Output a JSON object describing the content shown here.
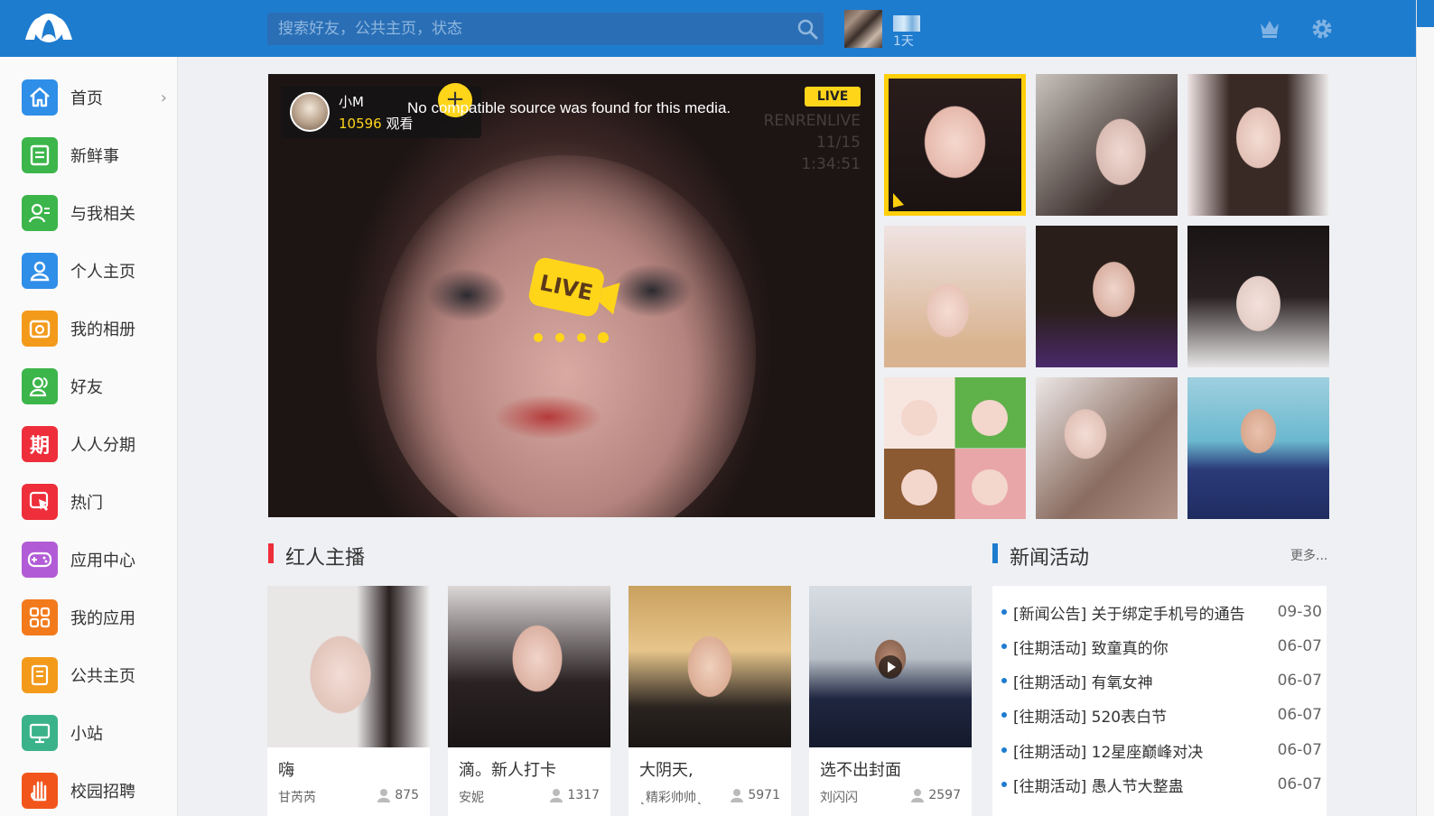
{
  "search": {
    "placeholder": "搜索好友，公共主页，状态"
  },
  "user": {
    "day_label": "1天"
  },
  "sidebar": {
    "items": [
      {
        "label": "首页",
        "icon": "home-icon",
        "color": "#2f8ee8"
      },
      {
        "label": "新鲜事",
        "icon": "news-feed-icon",
        "color": "#3cb54a"
      },
      {
        "label": "与我相关",
        "icon": "related-icon",
        "color": "#3cb54a"
      },
      {
        "label": "个人主页",
        "icon": "profile-icon",
        "color": "#2f8ee8"
      },
      {
        "label": "我的相册",
        "icon": "album-icon",
        "color": "#f39a1b"
      },
      {
        "label": "好友",
        "icon": "friends-icon",
        "color": "#3cb54a"
      },
      {
        "label": "人人分期",
        "icon": "installment-icon",
        "color": "#ee2e3a",
        "glyph": "期"
      },
      {
        "label": "热门",
        "icon": "hot-icon",
        "color": "#ee2e3a"
      },
      {
        "label": "应用中心",
        "icon": "gamepad-icon",
        "color": "#b25bd6"
      },
      {
        "label": "我的应用",
        "icon": "apps-icon",
        "color": "#f27a1b"
      },
      {
        "label": "公共主页",
        "icon": "public-page-icon",
        "color": "#f39a1b"
      },
      {
        "label": "小站",
        "icon": "station-icon",
        "color": "#3ab28a"
      },
      {
        "label": "校园招聘",
        "icon": "recruit-icon",
        "color": "#f2551b"
      }
    ]
  },
  "live": {
    "host_name": "小M",
    "viewers": "10596",
    "viewers_suffix": " 观看",
    "follow_label": "+",
    "error": "No compatible source was found for this media.",
    "badge": "LIVE",
    "watermark_line1": "RENRENLIVE 11/15",
    "watermark_line2": "1:34:51",
    "center_logo_text": "LIVE"
  },
  "sections": {
    "anchors_title": "红人主播",
    "news_title": "新闻活动",
    "more": "更多..."
  },
  "anchors": [
    {
      "title": "嗨",
      "name": "甘芮芮",
      "count": "875"
    },
    {
      "title": "滴。新人打卡",
      "name": "安妮",
      "count": "1317"
    },
    {
      "title": "大阴天,",
      "name": "˛精彩帅帅˛",
      "count": "5971"
    },
    {
      "title": "选不出封面",
      "name": "刘闪闪",
      "count": "2597"
    }
  ],
  "news": [
    {
      "title": "[新闻公告] 关于绑定手机号的通告",
      "date": "09-30"
    },
    {
      "title": "[往期活动] 致童真的你",
      "date": "06-07"
    },
    {
      "title": "[往期活动] 有氧女神",
      "date": "06-07"
    },
    {
      "title": "[往期活动] 520表白节",
      "date": "06-07"
    },
    {
      "title": "[往期活动] 12星座巅峰对决",
      "date": "06-07"
    },
    {
      "title": "[往期活动] 愚人节大整蛊",
      "date": "06-07"
    }
  ],
  "colors": {
    "brand": "#1e7ccf",
    "live_yellow": "#ffd51a",
    "anchors_accent": "#ee2e3a",
    "news_accent": "#1e7ccf"
  }
}
